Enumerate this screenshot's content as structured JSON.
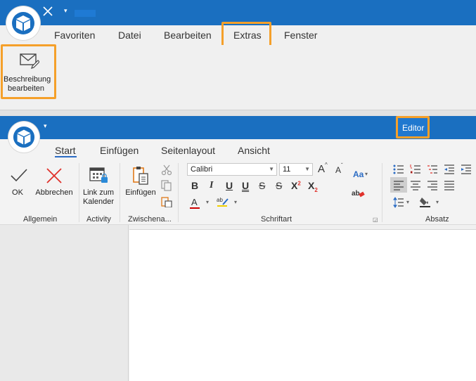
{
  "outer_window": {
    "menu": [
      "Favoriten",
      "Datei",
      "Bearbeiten",
      "Extras",
      "Fenster"
    ],
    "active_menu": "Extras",
    "edit_description_button": {
      "line1": "Beschreibung",
      "line2": "bearbeiten"
    }
  },
  "inner_window": {
    "badge": "Editor",
    "tabs": [
      "Start",
      "Einfügen",
      "Seitenlayout",
      "Ansicht"
    ],
    "active_tab": "Start",
    "groups": {
      "allgemein": {
        "label": "Allgemein",
        "ok": "OK",
        "cancel": "Abbrechen"
      },
      "activity": {
        "label": "Activity",
        "link_line1": "Link zum",
        "link_line2": "Kalender"
      },
      "clipboard": {
        "label": "Zwischena...",
        "paste": "Einfügen"
      },
      "font": {
        "label": "Schriftart",
        "font_name": "Calibri",
        "font_size": "11",
        "bold": "B",
        "italic": "I",
        "underline": "U",
        "double_underline": "U",
        "strike": "S",
        "strike2": "S",
        "superscript": "X²",
        "subscript": "X₂",
        "font_color": "A",
        "case_label": "Aa",
        "grow": "A",
        "shrink": "A",
        "clear": "ab"
      },
      "paragraph": {
        "label": "Absatz"
      }
    }
  },
  "colors": {
    "title_bar": "#1a6fc0",
    "highlight": "#f5a02a",
    "tab_underline": "#2b6cc4",
    "cancel_red": "#e0312b"
  }
}
